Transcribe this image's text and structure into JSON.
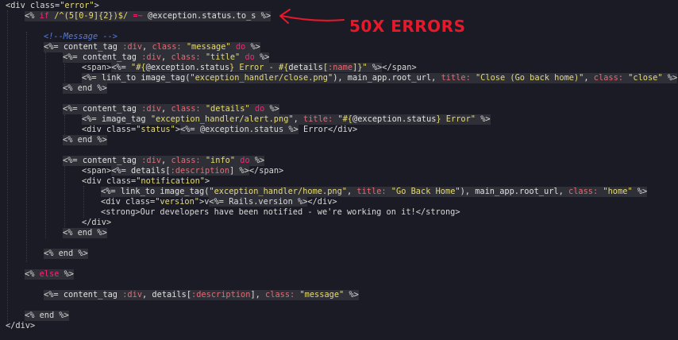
{
  "annotation": {
    "text": "50X ERRORS",
    "color": "#e8182b"
  },
  "code": {
    "l01": {
      "a": "<div class=",
      "b": "\"error\"",
      "c": ">"
    },
    "l02": {
      "a": "<%",
      "b": " if ",
      "c": "/^(5[0-9]{2})$/",
      "d": " =~ ",
      "e": "@exception.status.to_s",
      "f": " %>"
    },
    "l03": {
      "a": "<!--Message -->"
    },
    "l04": {
      "a": "<%= ",
      "b": "content_tag ",
      "c": ":div",
      "d": ", ",
      "e": "class:",
      "f": " \"message\"",
      "g": " do ",
      "h": "%>"
    },
    "l05": {
      "a": "<%= ",
      "b": "content_tag ",
      "c": ":div",
      "d": ", ",
      "e": "class:",
      "f": " \"title\"",
      "g": " do ",
      "h": "%>"
    },
    "l06": {
      "a": "<span>",
      "b": "<%= ",
      "c": "\"#{",
      "d": "@exception.status",
      "e": "} Error - #{",
      "f": "details",
      "g": "[",
      "h": ":name",
      "i": "]}\"",
      "j": " %>",
      "k": "</span>"
    },
    "l07": {
      "a": "<%= ",
      "b": "link_to image_tag(",
      "c": "\"exception_handler/close.png\"",
      "d": "), main_app.root_url, ",
      "e": "title:",
      "f": " \"Close (Go back home)\"",
      "g": ", ",
      "h": "class:",
      "i": " \"close\"",
      "j": " %>"
    },
    "l08": {
      "a": "<% end %>"
    },
    "l09": {
      "a": "<%= ",
      "b": "content_tag ",
      "c": ":div",
      "d": ", ",
      "e": "class:",
      "f": " \"details\"",
      "g": " do ",
      "h": "%>"
    },
    "l10": {
      "a": "<%= ",
      "b": "image_tag ",
      "c": "\"exception_handler/alert.png\"",
      "d": ", ",
      "e": "title:",
      "f": " \"#{",
      "g": "@exception.status",
      "h": "} Error\"",
      "i": " %>"
    },
    "l11": {
      "a": "<div class=",
      "b": "\"status\"",
      "c": ">",
      "d": "<%= @exception.status %>",
      "e": " Error</div>"
    },
    "l12": {
      "a": "<% end %>"
    },
    "l13": {
      "a": "<%= ",
      "b": "content_tag ",
      "c": ":div",
      "d": ", ",
      "e": "class:",
      "f": " \"info\"",
      "g": " do ",
      "h": "%>"
    },
    "l14": {
      "a": "<span>",
      "b": "<%= ",
      "c": "details[",
      "d": ":description",
      "e": "] %>",
      "f": "</span>"
    },
    "l15": {
      "a": "<div class=",
      "b": "\"notification\"",
      "c": ">"
    },
    "l16": {
      "a": "<%= ",
      "b": "link_to image_tag(",
      "c": "\"exception_handler/home.png\"",
      "d": ", ",
      "e": "title:",
      "f": " \"Go Back Home\"",
      "g": "), main_app.root_url, ",
      "h": "class:",
      "i": " \"home\"",
      "j": " %>"
    },
    "l17": {
      "a": "<div class=",
      "b": "\"version\"",
      "c": ">v",
      "d": "<%= Rails.version %>",
      "e": "</div>"
    },
    "l18": {
      "a": "<strong>Our developers have been notified - we're working on it!</strong>"
    },
    "l19": {
      "a": "</div>"
    },
    "l20": {
      "a": "<% end %>"
    },
    "l21": {
      "a": "<% end %>"
    },
    "l22": {
      "a": "<%",
      "b": " else ",
      "c": "%>"
    },
    "l23": {
      "a": "<%= ",
      "b": "content_tag ",
      "c": ":div",
      "d": ", details[",
      "e": ":description",
      "f": "], ",
      "g": "class:",
      "h": " \"message\"",
      "i": " %>"
    },
    "l24": {
      "a": "<% end %>"
    },
    "l25": {
      "a": "</div>"
    }
  }
}
